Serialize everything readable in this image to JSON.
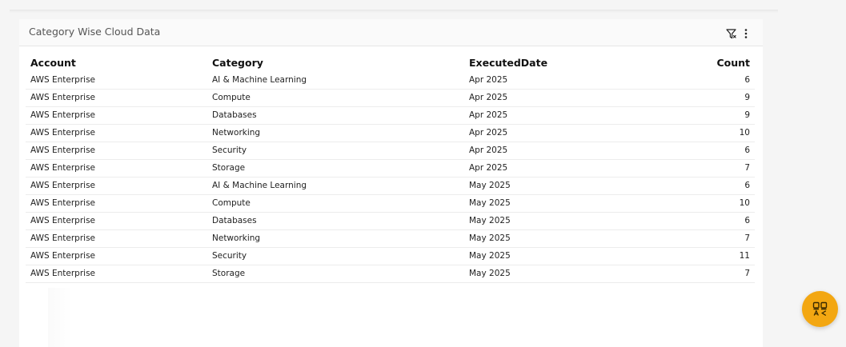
{
  "widget": {
    "title": "Category Wise Cloud Data"
  },
  "icons": {
    "filter": "filter-icon",
    "more": "more-vertical-icon",
    "fab": "translate-icon"
  },
  "colors": {
    "accent": "#f3a712"
  },
  "table": {
    "headers": {
      "account": "Account",
      "category": "Category",
      "executed_date": "ExecutedDate",
      "count": "Count"
    },
    "rows": [
      {
        "account": "AWS Enterprise",
        "category": "AI & Machine Learning",
        "date": "Apr 2025",
        "count": "6"
      },
      {
        "account": "AWS Enterprise",
        "category": "Compute",
        "date": "Apr 2025",
        "count": "9"
      },
      {
        "account": "AWS Enterprise",
        "category": "Databases",
        "date": "Apr 2025",
        "count": "9"
      },
      {
        "account": "AWS Enterprise",
        "category": "Networking",
        "date": "Apr 2025",
        "count": "10"
      },
      {
        "account": "AWS Enterprise",
        "category": "Security",
        "date": "Apr 2025",
        "count": "6"
      },
      {
        "account": "AWS Enterprise",
        "category": "Storage",
        "date": "Apr 2025",
        "count": "7"
      },
      {
        "account": "AWS Enterprise",
        "category": "AI & Machine Learning",
        "date": "May 2025",
        "count": "6"
      },
      {
        "account": "AWS Enterprise",
        "category": "Compute",
        "date": "May 2025",
        "count": "10"
      },
      {
        "account": "AWS Enterprise",
        "category": "Databases",
        "date": "May 2025",
        "count": "6"
      },
      {
        "account": "AWS Enterprise",
        "category": "Networking",
        "date": "May 2025",
        "count": "7"
      },
      {
        "account": "AWS Enterprise",
        "category": "Security",
        "date": "May 2025",
        "count": "11"
      },
      {
        "account": "AWS Enterprise",
        "category": "Storage",
        "date": "May 2025",
        "count": "7"
      }
    ]
  }
}
